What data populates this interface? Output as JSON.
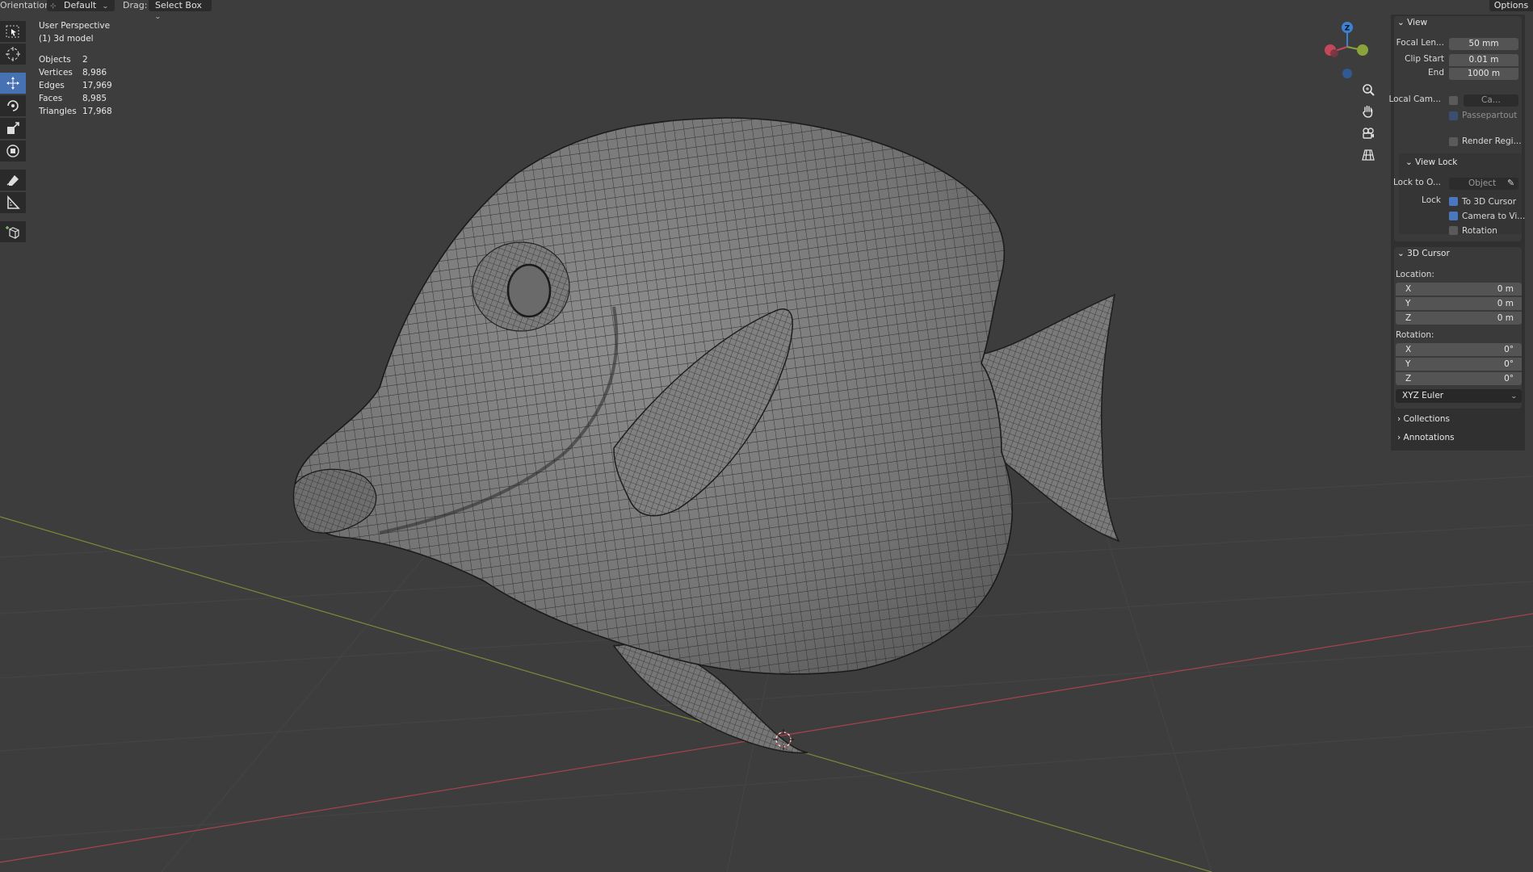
{
  "header": {
    "orientation_label": "Orientation:",
    "orientation_value": "Default",
    "drag_label": "Drag:",
    "drag_value": "Select Box",
    "options_label": "Options"
  },
  "overlay": {
    "view_name": "User Perspective",
    "object_name": "(1) 3d model",
    "stats": [
      {
        "label": "Objects",
        "value": "2"
      },
      {
        "label": "Vertices",
        "value": "8,986"
      },
      {
        "label": "Edges",
        "value": "17,969"
      },
      {
        "label": "Faces",
        "value": "8,985"
      },
      {
        "label": "Triangles",
        "value": "17,968"
      }
    ]
  },
  "gizmo": {
    "z_label": "Z"
  },
  "toolbar": {
    "tools": [
      "select-box",
      "cursor",
      "move",
      "rotate",
      "scale",
      "transform",
      "annotate",
      "measure",
      "add-cube"
    ],
    "active": "move"
  },
  "sidebar": {
    "view_header": "View",
    "focal_length_label": "Focal Len...",
    "focal_length_value": "50 mm",
    "clip_start_label": "Clip Start",
    "clip_start_value": "0.01 m",
    "clip_end_label": "End",
    "clip_end_value": "1000 m",
    "local_camera_label": "Local Cam...",
    "local_camera_value": "Ca...",
    "passepartout_label": "Passepartout",
    "render_region_label": "Render Regi...",
    "view_lock_header": "View Lock",
    "lock_to_object_label": "Lock to O...",
    "lock_to_object_placeholder": "Object",
    "lock_label": "Lock",
    "lock_to_cursor_label": "To 3D Cursor",
    "lock_camera_label": "Camera to Vi...",
    "lock_rotation_label": "Rotation",
    "cursor_header": "3D Cursor",
    "location_label": "Location:",
    "location": [
      {
        "axis": "X",
        "value": "0 m"
      },
      {
        "axis": "Y",
        "value": "0 m"
      },
      {
        "axis": "Z",
        "value": "0 m"
      }
    ],
    "rotation_label": "Rotation:",
    "rotation": [
      {
        "axis": "X",
        "value": "0°"
      },
      {
        "axis": "Y",
        "value": "0°"
      },
      {
        "axis": "Z",
        "value": "0°"
      }
    ],
    "rotation_mode": "XYZ Euler",
    "collections_header": "Collections",
    "annotations_header": "Annotations"
  },
  "colors": {
    "background": "#3d3d3d",
    "accent": "#4672b4",
    "x_axis": "#c4485a",
    "y_axis": "#8aa33a",
    "z_axis": "#3b82d6"
  }
}
